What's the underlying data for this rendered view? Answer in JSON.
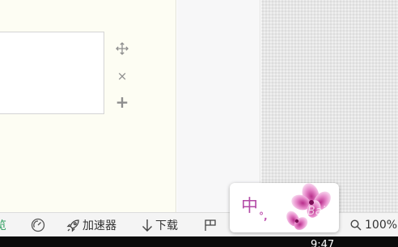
{
  "frame_tools": {
    "move_symbol": "✥",
    "close_symbol": "×",
    "add_symbol": "+"
  },
  "statusbar": {
    "preview_label": "览",
    "accelerator_label": "加速器",
    "download_label": "下载",
    "zoom_label": "100%"
  },
  "ime": {
    "mode_char": "中",
    "punct_symbol": "°,"
  },
  "watermark": "Baidu",
  "taskbar": {
    "time": "9:47"
  },
  "colors": {
    "page_bg": "#fdfdf3",
    "preview_green": "#2e9e5e",
    "ime_purple": "#b34aa6",
    "taskbar_bg": "#0b0b0b"
  }
}
